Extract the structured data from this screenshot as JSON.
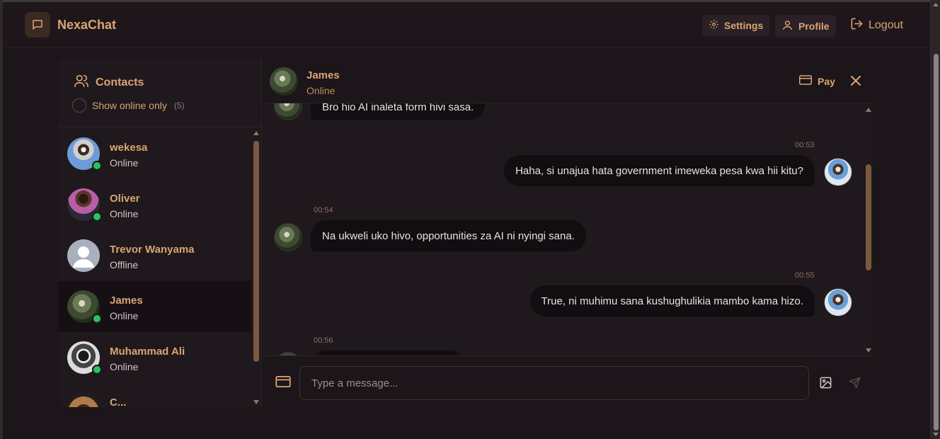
{
  "app": {
    "brand": "NexaChat"
  },
  "header": {
    "settings_label": "Settings",
    "profile_label": "Profile",
    "logout_label": "Logout"
  },
  "sidebar": {
    "title": "Contacts",
    "online_only_label": "Show online only",
    "online_count": "(5)",
    "contacts": [
      {
        "name": "wekesa",
        "status": "Online"
      },
      {
        "name": "Oliver",
        "status": "Online"
      },
      {
        "name": "Trevor Wanyama",
        "status": "Offline"
      },
      {
        "name": "James",
        "status": "Online"
      },
      {
        "name": "Muhammad Ali",
        "status": "Online"
      },
      {
        "name": "C..."
      }
    ]
  },
  "chat": {
    "contact_name": "James",
    "contact_status": "Online",
    "pay_label": "Pay",
    "messages": [
      {
        "from": "theirs",
        "time": "",
        "text": "Bro hio AI inaleta form hivi sasa."
      },
      {
        "from": "mine",
        "time": "00:53",
        "text": "Haha, si unajua hata government imeweka pesa kwa hii kitu?"
      },
      {
        "from": "theirs",
        "time": "00:54",
        "text": "Na ukweli uko hivo, opportunities za AI ni nyingi sana."
      },
      {
        "from": "mine",
        "time": "00:55",
        "text": "True, ni muhimu sana kushughulikia mambo kama hizo."
      },
      {
        "from": "theirs",
        "time": "00:56",
        "text": ""
      }
    ],
    "input_placeholder": "Type a message..."
  },
  "colors": {
    "accent": "#d9a574",
    "background": "#1c1519",
    "online": "#22c55e",
    "bubble": "#120d10"
  }
}
